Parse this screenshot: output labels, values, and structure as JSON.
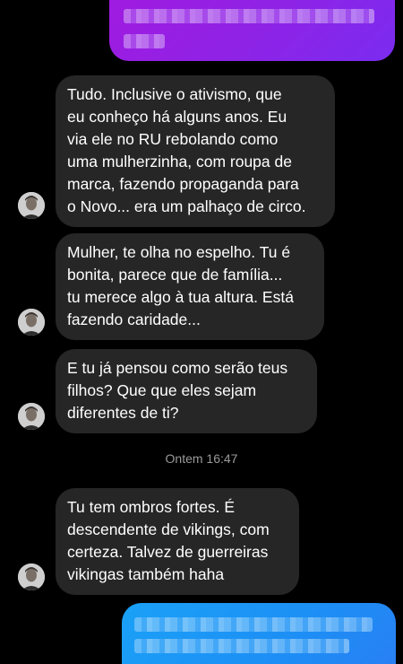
{
  "conversation": {
    "messages_in": [
      {
        "text": "Tudo. Inclusive o ativismo, que\neu conheço há alguns anos. Eu\nvia ele no RU rebolando como\numa mulherzinha, com roupa de\nmarca, fazendo propaganda para\no Novo... era um palhaço de circo."
      },
      {
        "text": "Mulher, te olha no espelho. Tu é\nbonita, parece que de família...\ntu merece algo à tua altura. Está\nfazendo caridade..."
      },
      {
        "text": "E tu já pensou como serão teus\nfilhos? Que que eles sejam\ndiferentes de ti?"
      },
      {
        "text": "Tu tem ombros fortes. É\ndescendente de vikings, com\ncerteza. Talvez de guerreiras\nvikingas também haha"
      }
    ],
    "timestamp": "Ontem 16:47"
  },
  "icons": {
    "avatar": "profile-photo-icon"
  },
  "colors": {
    "background": "#000000",
    "incoming_bubble": "#262626",
    "outgoing_top": "#9b1fe3",
    "outgoing_bottom": "#1d8ef5",
    "timestamp_text": "#9a9a9a"
  }
}
